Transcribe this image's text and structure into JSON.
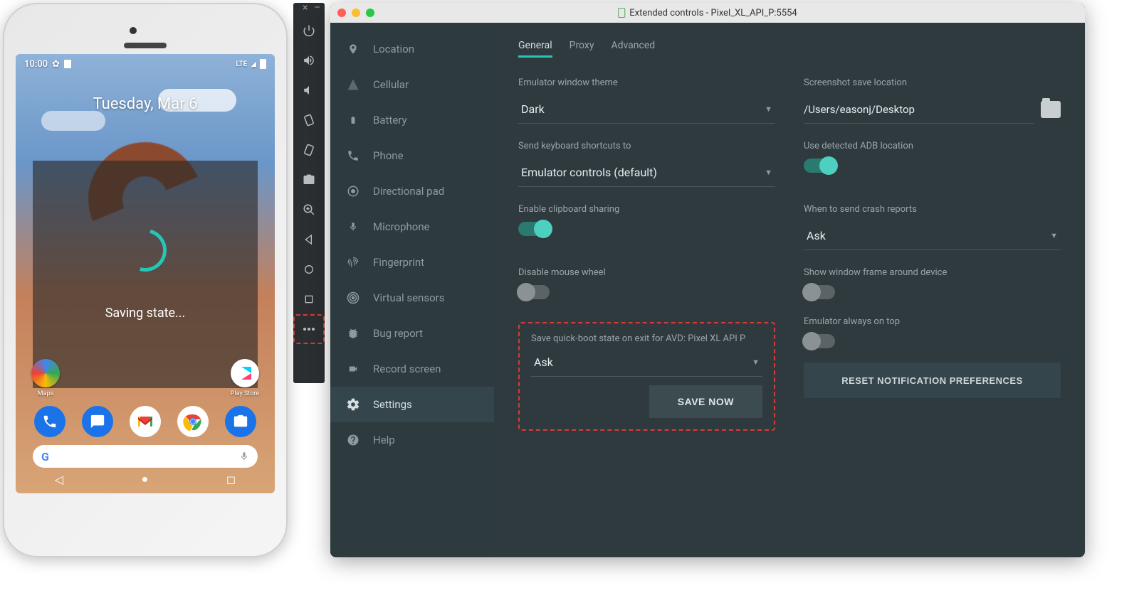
{
  "phone": {
    "status_time": "10:00",
    "status_network": "LTE",
    "date": "Tuesday, Mar 6",
    "saving_text": "Saving state...",
    "apps": {
      "maps": "Maps",
      "playstore": "Play Store"
    },
    "search_letter": "G"
  },
  "toolbar": {
    "buttons": [
      "power",
      "volume-up",
      "volume-down",
      "rotate-left",
      "rotate-right",
      "camera",
      "zoom",
      "back",
      "home",
      "recents",
      "more"
    ]
  },
  "window": {
    "title": "Extended controls - Pixel_XL_API_P:5554"
  },
  "sidebar": {
    "items": [
      {
        "icon": "location",
        "label": "Location"
      },
      {
        "icon": "cellular",
        "label": "Cellular"
      },
      {
        "icon": "battery",
        "label": "Battery"
      },
      {
        "icon": "phone",
        "label": "Phone"
      },
      {
        "icon": "dpad",
        "label": "Directional pad"
      },
      {
        "icon": "mic",
        "label": "Microphone"
      },
      {
        "icon": "fingerprint",
        "label": "Fingerprint"
      },
      {
        "icon": "sensors",
        "label": "Virtual sensors"
      },
      {
        "icon": "bug",
        "label": "Bug report"
      },
      {
        "icon": "record",
        "label": "Record screen"
      },
      {
        "icon": "settings",
        "label": "Settings"
      },
      {
        "icon": "help",
        "label": "Help"
      }
    ],
    "active_index": 10
  },
  "tabs": {
    "items": [
      "General",
      "Proxy",
      "Advanced"
    ],
    "active_index": 0
  },
  "settings": {
    "theme_label": "Emulator window theme",
    "theme_value": "Dark",
    "screenshot_label": "Screenshot save location",
    "screenshot_path": "/Users/easonj/Desktop",
    "shortcuts_label": "Send keyboard shortcuts to",
    "shortcuts_value": "Emulator controls (default)",
    "adb_label": "Use detected ADB location",
    "adb_on": true,
    "clipboard_label": "Enable clipboard sharing",
    "clipboard_on": true,
    "crash_label": "When to send crash reports",
    "crash_value": "Ask",
    "mouse_label": "Disable mouse wheel",
    "mouse_on": false,
    "frame_label": "Show window frame around device",
    "frame_on": false,
    "quickboot_label": "Save quick-boot state on exit for AVD: Pixel XL API P",
    "quickboot_value": "Ask",
    "save_now": "SAVE NOW",
    "always_top_label": "Emulator always on top",
    "always_top_on": false,
    "reset_btn": "RESET NOTIFICATION PREFERENCES"
  }
}
